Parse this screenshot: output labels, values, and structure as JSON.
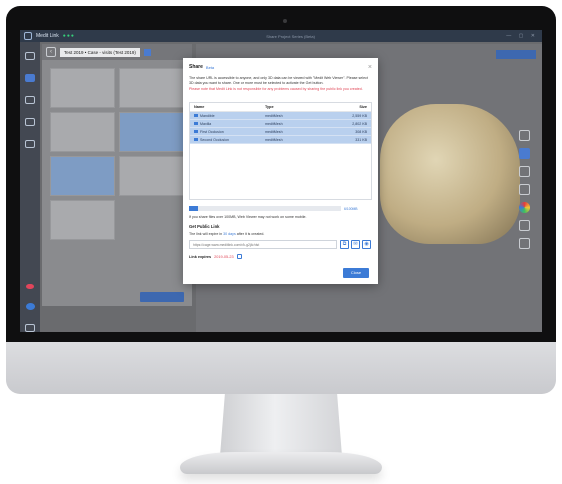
{
  "app": {
    "name": "Medit Link",
    "status_dots": "●●●",
    "window_title": "Share Project Series (Beta)"
  },
  "case": {
    "name": "Test 2019 • Case - visits (Test 2019)"
  },
  "modal": {
    "title": "Share",
    "subtitle": "Beta",
    "close_glyph": "×",
    "description": "The share URL is accessible to anyone, and only 3D data can be viewed with \"Medit Web Viewer\". Please select 3D data you want to share. One or more must be selected to activate the Get button.",
    "warning": "Please note that Medit Link is not responsible for any problems caused by sharing the public link you created.",
    "table": {
      "headers": {
        "name": "Name",
        "type": "Type",
        "size": "Size"
      },
      "rows": [
        {
          "name": "Mandible",
          "type": "meditMesh",
          "size": "2,559 KB"
        },
        {
          "name": "Maxilla",
          "type": "meditMesh",
          "size": "2,802 KB"
        },
        {
          "name": "First Occlusion",
          "type": "meditMesh",
          "size": "308 KB"
        },
        {
          "name": "Second Occlusion",
          "type": "meditMesh",
          "size": "331 KB"
        }
      ]
    },
    "progress": {
      "fraction": 0.06,
      "text": "6/100MB"
    },
    "size_note": "If you share files over 100MB, Web Viewer may not work on some mobile.",
    "public_link": {
      "heading": "Get Public Link",
      "expire_note_prefix": "The link will expire in ",
      "expire_days": "30 days",
      "expire_note_suffix": " after it is created.",
      "url_placeholder": "https://cage.www.meditlink.com/r/k-g2j4r/dst"
    },
    "expires": {
      "label": "Link expires",
      "date": "2019-05-23"
    },
    "close_label": "Close"
  },
  "colors": {
    "accent": "#3c7bd6",
    "warning": "#e04455",
    "selected_row": "#b9d0ee"
  }
}
